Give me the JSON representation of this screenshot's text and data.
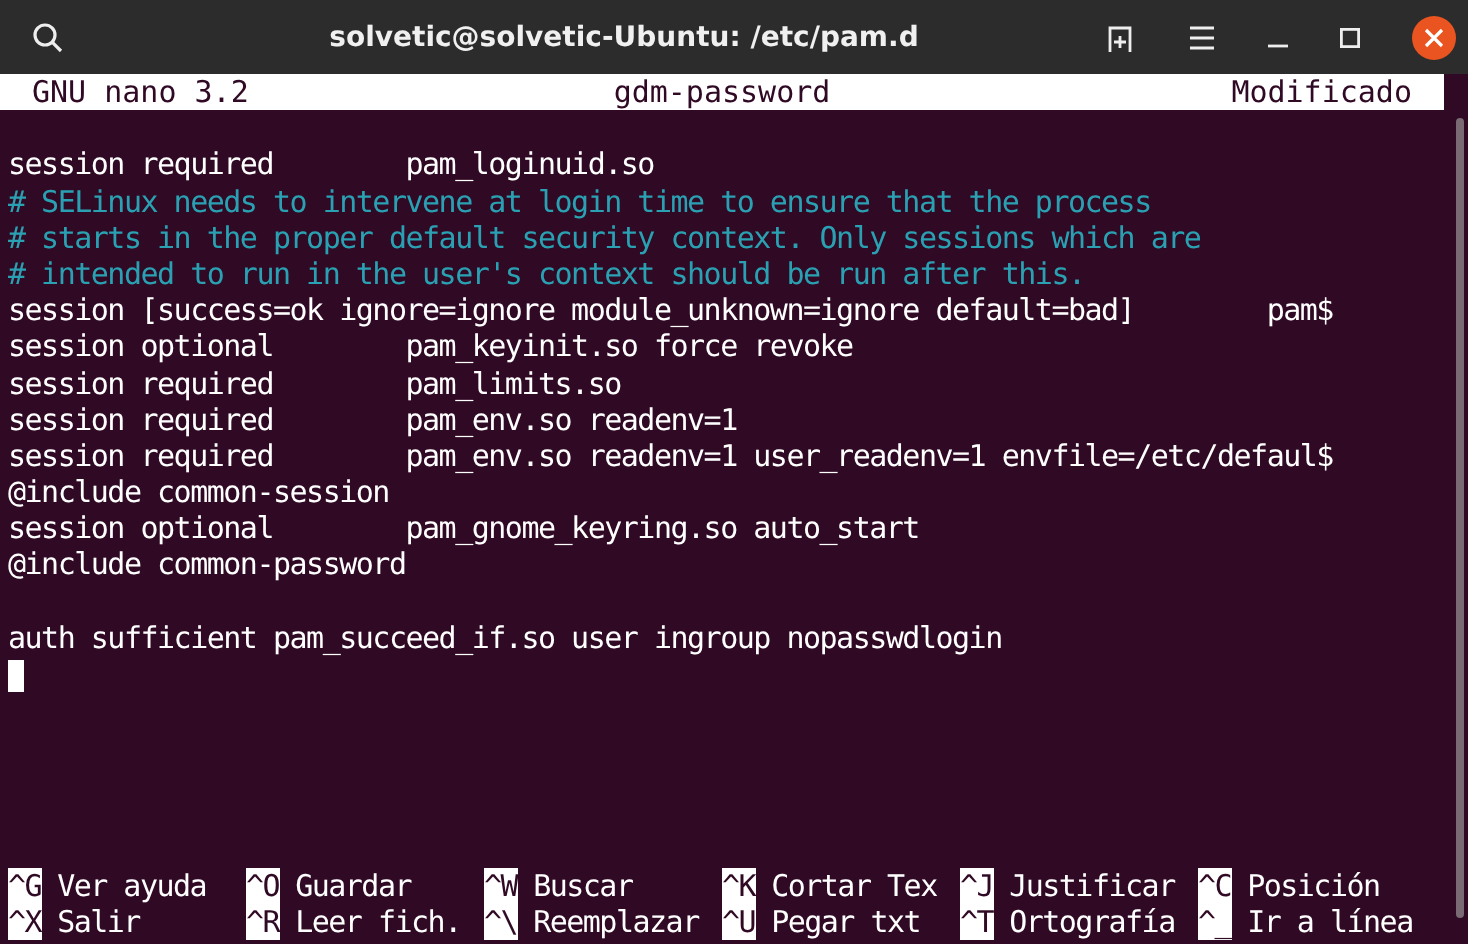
{
  "window": {
    "title": "solvetic@solvetic-Ubuntu: /etc/pam.d"
  },
  "nano_header": {
    "version": "GNU nano 3.2",
    "filename": "gdm-password",
    "status": "Modificado"
  },
  "lines": [
    {
      "kind": "blank"
    },
    {
      "kind": "code",
      "text": "session required        pam_loginuid.so"
    },
    {
      "kind": "comment",
      "text": "# SELinux needs to intervene at login time to ensure that the process"
    },
    {
      "kind": "comment",
      "text": "# starts in the proper default security context. Only sessions which are"
    },
    {
      "kind": "comment",
      "text": "# intended to run in the user's context should be run after this."
    },
    {
      "kind": "code",
      "text": "session [success=ok ignore=ignore module_unknown=ignore default=bad]        pam$"
    },
    {
      "kind": "code",
      "text": "session optional        pam_keyinit.so force revoke"
    },
    {
      "kind": "code",
      "text": "session required        pam_limits.so"
    },
    {
      "kind": "code",
      "text": "session required        pam_env.so readenv=1"
    },
    {
      "kind": "code",
      "text": "session required        pam_env.so readenv=1 user_readenv=1 envfile=/etc/defaul$"
    },
    {
      "kind": "code",
      "text": "@include common-session"
    },
    {
      "kind": "code",
      "text": "session optional        pam_gnome_keyring.so auto_start"
    },
    {
      "kind": "code",
      "text": "@include common-password"
    },
    {
      "kind": "blank"
    },
    {
      "kind": "code",
      "text": "auth sufficient pam_succeed_if.so user ingroup nopasswdlogin"
    },
    {
      "kind": "cursor"
    }
  ],
  "shortcuts": [
    [
      {
        "key": "^G",
        "label": "Ver ayuda"
      },
      {
        "key": "^O",
        "label": "Guardar"
      },
      {
        "key": "^W",
        "label": "Buscar"
      },
      {
        "key": "^K",
        "label": "Cortar Tex"
      },
      {
        "key": "^J",
        "label": "Justificar"
      },
      {
        "key": "^C",
        "label": "Posición"
      }
    ],
    [
      {
        "key": "^X",
        "label": "Salir"
      },
      {
        "key": "^R",
        "label": "Leer fich."
      },
      {
        "key": "^\\",
        "label": "Reemplazar"
      },
      {
        "key": "^U",
        "label": "Pegar txt"
      },
      {
        "key": "^T",
        "label": "Ortografía"
      },
      {
        "key": "^_",
        "label": "Ir a línea"
      }
    ]
  ]
}
